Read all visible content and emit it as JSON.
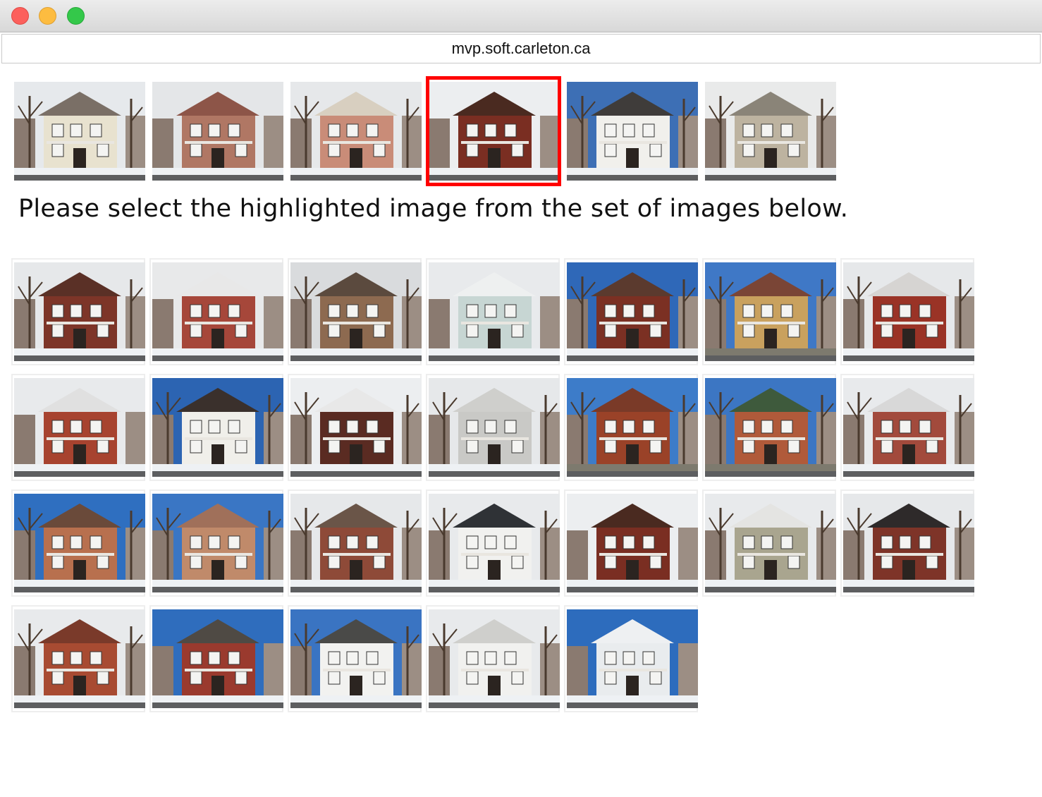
{
  "window": {
    "url": "mvp.soft.carleton.ca"
  },
  "instruction": "Please select the highlighted image from the set of images below.",
  "target_images": [
    {
      "icon": "house-photo",
      "sky": "#e6e9ec",
      "wall": "#e8e2cf",
      "roof": "#7a6f66",
      "trees": true,
      "snow": true
    },
    {
      "icon": "house-photo",
      "sky": "#e4e6e8",
      "wall": "#b07764",
      "roof": "#8d5548",
      "trees": false,
      "snow": true
    },
    {
      "icon": "house-photo",
      "sky": "#e6e8ea",
      "wall": "#c98c78",
      "roof": "#d8cfc0",
      "trees": true,
      "snow": true
    },
    {
      "icon": "house-photo",
      "sky": "#eceef0",
      "wall": "#7a2e22",
      "roof": "#4a2a20",
      "trees": false,
      "snow": true,
      "selected": true
    },
    {
      "icon": "house-photo",
      "sky": "#3d6fb5",
      "wall": "#f1f0ec",
      "roof": "#3f3c3a",
      "trees": true,
      "snow": true
    },
    {
      "icon": "house-photo",
      "sky": "#e9eaea",
      "wall": "#bdb3a0",
      "roof": "#8a8478",
      "trees": true,
      "snow": true
    }
  ],
  "candidate_images": [
    {
      "icon": "house-photo",
      "sky": "#e6e8ea",
      "wall": "#7d3528",
      "roof": "#5a3026",
      "trees": true,
      "snow": true
    },
    {
      "icon": "house-photo",
      "sky": "#e8e9ea",
      "wall": "#a6473a",
      "roof": "#e8e8e8",
      "trees": false,
      "snow": true
    },
    {
      "icon": "house-photo",
      "sky": "#d9dbdd",
      "wall": "#8d6a50",
      "roof": "#5b4a3e",
      "trees": true,
      "snow": true
    },
    {
      "icon": "house-photo",
      "sky": "#e8eaec",
      "wall": "#c7d6d3",
      "roof": "#eef0f0",
      "trees": false,
      "snow": true
    },
    {
      "icon": "house-photo",
      "sky": "#2f68b8",
      "wall": "#7b3023",
      "roof": "#5b3a2e",
      "trees": true,
      "snow": true
    },
    {
      "icon": "house-photo",
      "sky": "#3f78c6",
      "wall": "#c9a15e",
      "roof": "#7a4536",
      "trees": true,
      "snow": false
    },
    {
      "icon": "house-photo",
      "sky": "#e6e8ea",
      "wall": "#9a3326",
      "roof": "#d6d4d2",
      "trees": true,
      "snow": true
    },
    {
      "icon": "house-photo",
      "sky": "#e8eaec",
      "wall": "#a7432f",
      "roof": "#e0e0e0",
      "trees": false,
      "snow": true
    },
    {
      "icon": "house-photo",
      "sky": "#2c64b2",
      "wall": "#f0efea",
      "roof": "#3a302c",
      "trees": true,
      "snow": true
    },
    {
      "icon": "house-photo",
      "sky": "#eceef0",
      "wall": "#5a2b22",
      "roof": "#e8e8e8",
      "trees": true,
      "snow": true
    },
    {
      "icon": "house-photo",
      "sky": "#e6e8ea",
      "wall": "#c9c9c6",
      "roof": "#cfcfcc",
      "trees": true,
      "snow": true
    },
    {
      "icon": "house-photo",
      "sky": "#3d7cc9",
      "wall": "#9a4228",
      "roof": "#7a3a28",
      "trees": true,
      "snow": false
    },
    {
      "icon": "house-photo",
      "sky": "#3c76c3",
      "wall": "#b05a3a",
      "roof": "#3e5a3c",
      "trees": true,
      "snow": false
    },
    {
      "icon": "house-photo",
      "sky": "#e8eaec",
      "wall": "#a24a3c",
      "roof": "#d8d8d8",
      "trees": true,
      "snow": true
    },
    {
      "icon": "house-photo",
      "sky": "#2f6fc0",
      "wall": "#b8704e",
      "roof": "#6a4a3a",
      "trees": true,
      "snow": true
    },
    {
      "icon": "house-photo",
      "sky": "#3a76c4",
      "wall": "#c08a6a",
      "roof": "#a0705a",
      "trees": true,
      "snow": true
    },
    {
      "icon": "house-photo",
      "sky": "#e6e8ea",
      "wall": "#8e4a38",
      "roof": "#6a5548",
      "trees": true,
      "snow": true
    },
    {
      "icon": "house-photo",
      "sky": "#e8eaec",
      "wall": "#f1f1ef",
      "roof": "#2f3236",
      "trees": true,
      "snow": true
    },
    {
      "icon": "house-photo",
      "sky": "#eceef0",
      "wall": "#7a2e22",
      "roof": "#4a2a20",
      "trees": false,
      "snow": true
    },
    {
      "icon": "house-photo",
      "sky": "#e8eaec",
      "wall": "#a9a58f",
      "roof": "#e4e4e2",
      "trees": true,
      "snow": true
    },
    {
      "icon": "house-photo",
      "sky": "#e6e8ea",
      "wall": "#7e3428",
      "roof": "#2e2a2a",
      "trees": true,
      "snow": true
    },
    {
      "icon": "house-photo",
      "sky": "#e8eaec",
      "wall": "#a84b32",
      "roof": "#7a3a2a",
      "trees": true,
      "snow": true
    },
    {
      "icon": "house-photo",
      "sky": "#2f6dbd",
      "wall": "#9a3a2e",
      "roof": "#4f4a44",
      "trees": false,
      "snow": true
    },
    {
      "icon": "house-photo",
      "sky": "#3a74c2",
      "wall": "#f2f2f0",
      "roof": "#4a4a48",
      "trees": true,
      "snow": true
    },
    {
      "icon": "house-photo",
      "sky": "#e8eaec",
      "wall": "#f1f1ef",
      "roof": "#cfcfcc",
      "trees": true,
      "snow": true
    },
    {
      "icon": "house-photo",
      "sky": "#2d6cbd",
      "wall": "#e9ecee",
      "roof": "#eef0f2",
      "trees": false,
      "snow": true
    }
  ]
}
